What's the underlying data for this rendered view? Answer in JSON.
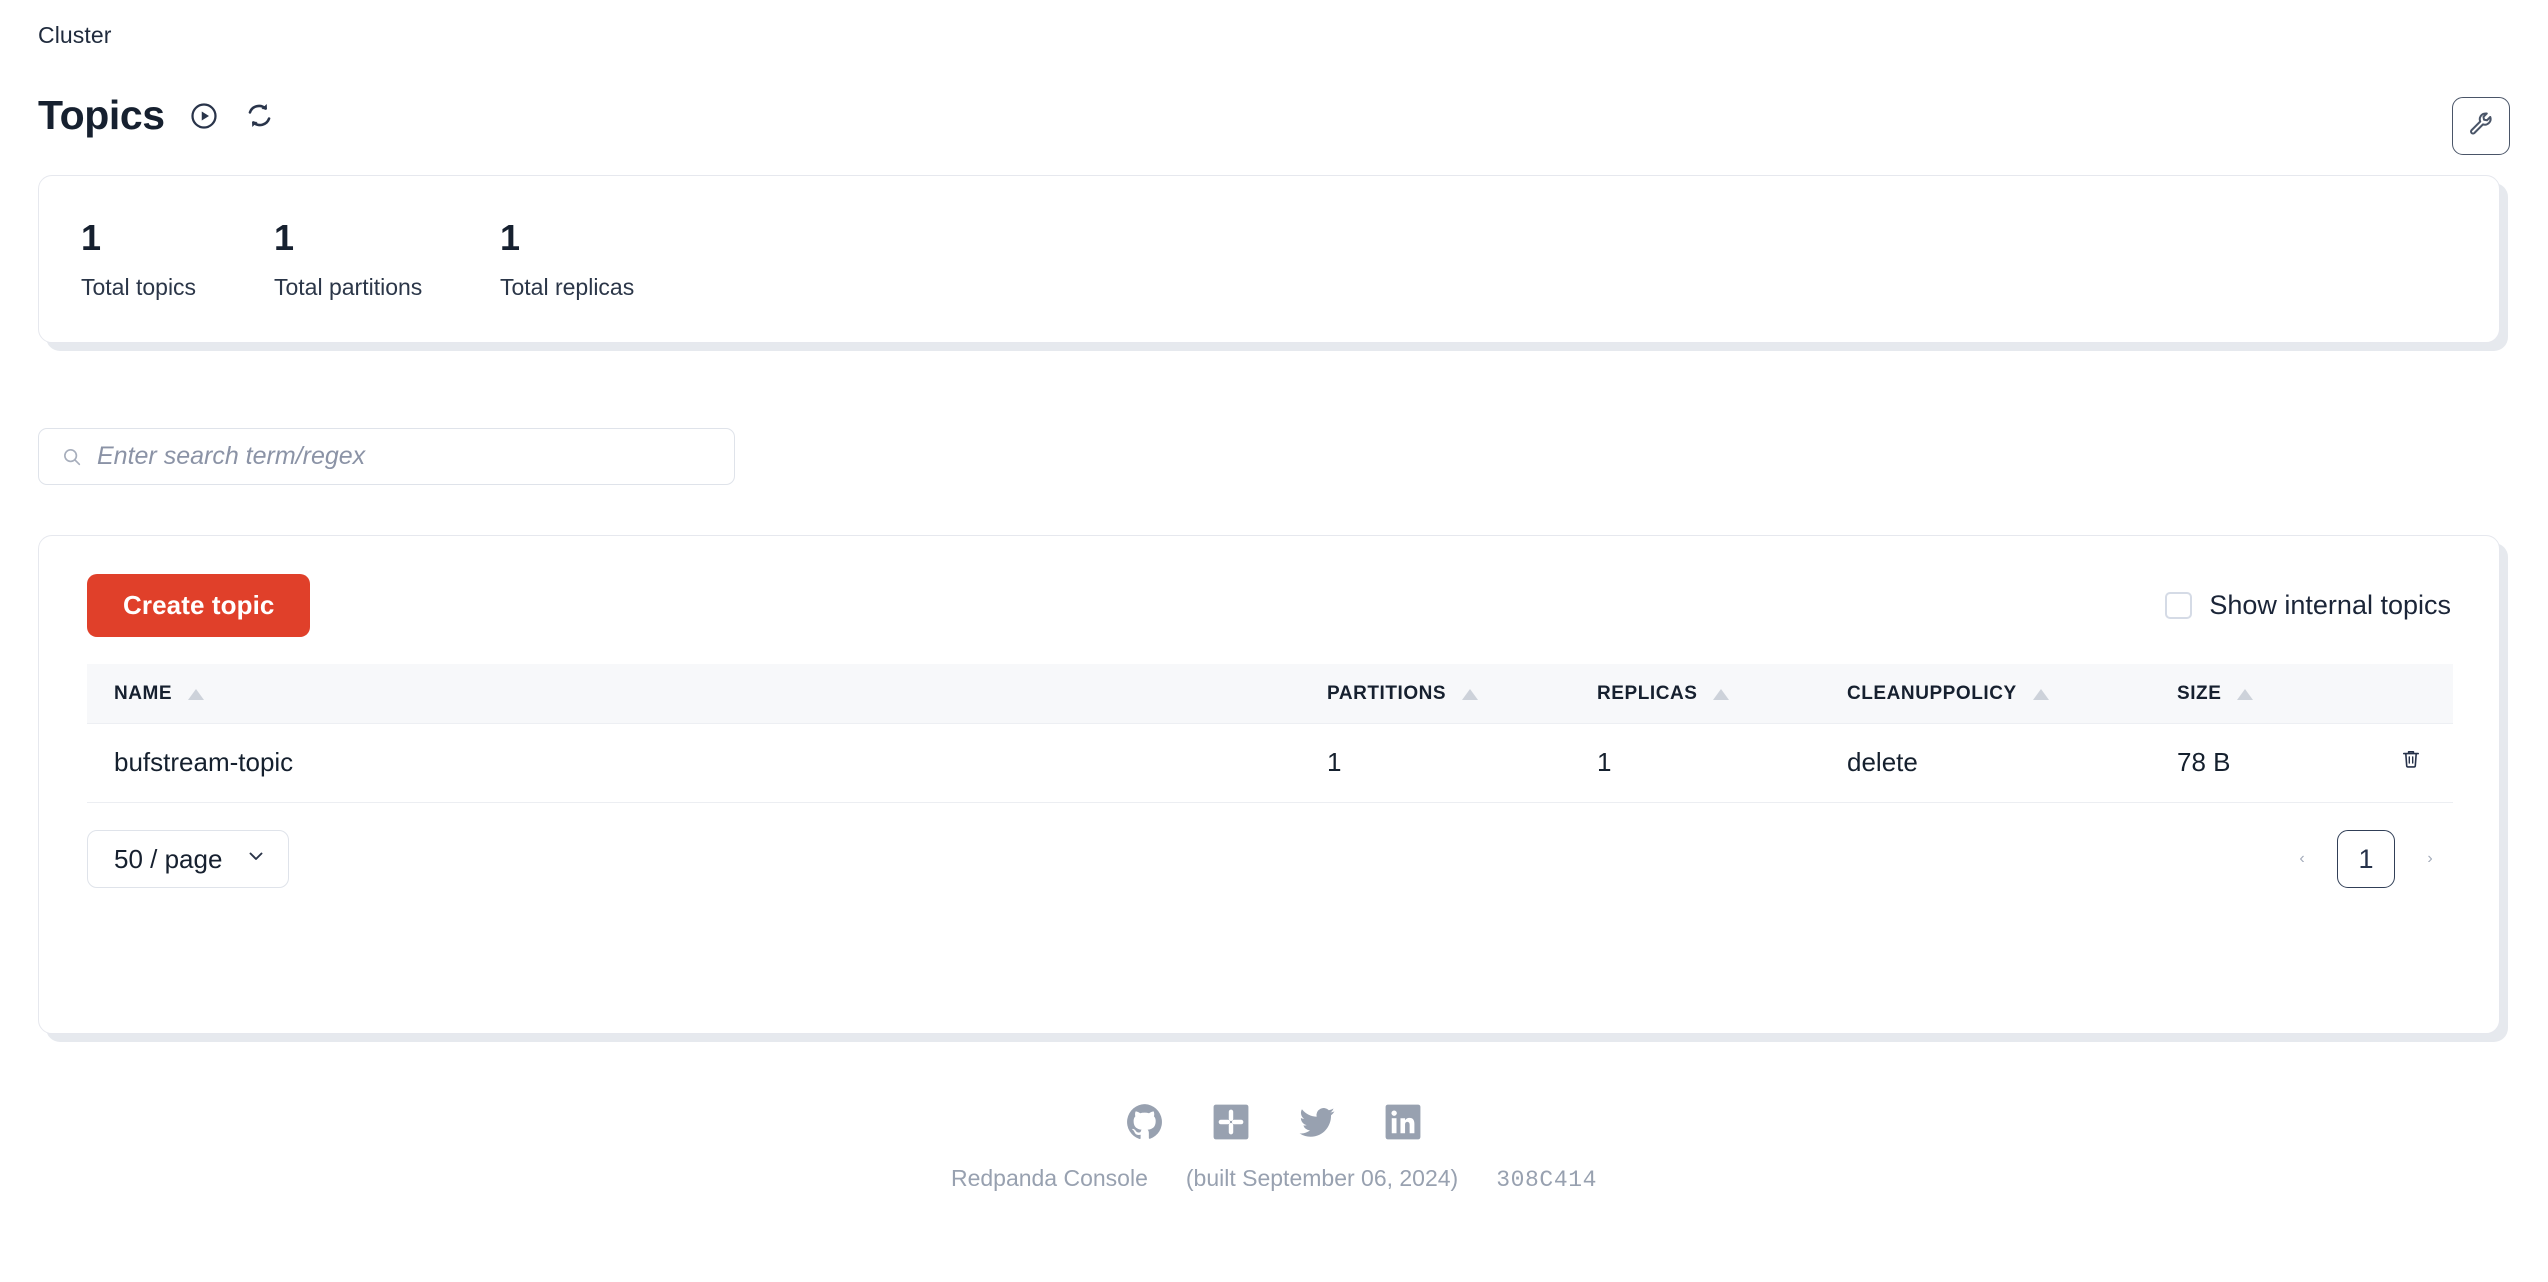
{
  "breadcrumb": "Cluster",
  "header": {
    "title": "Topics",
    "play_icon": "play-circle-icon",
    "refresh_icon": "refresh-icon",
    "tool_icon": "wrench-icon"
  },
  "stats": [
    {
      "value": "1",
      "label": "Total topics"
    },
    {
      "value": "1",
      "label": "Total partitions"
    },
    {
      "value": "1",
      "label": "Total replicas"
    }
  ],
  "search": {
    "placeholder": "Enter search term/regex",
    "value": "",
    "icon": "search-icon"
  },
  "toolbar": {
    "create_label": "Create topic",
    "internal_checkbox_label": "Show internal topics",
    "internal_checkbox_checked": false
  },
  "table": {
    "columns": [
      {
        "key": "name",
        "label": "NAME",
        "sortable": true
      },
      {
        "key": "partitions",
        "label": "PARTITIONS",
        "sortable": true
      },
      {
        "key": "replicas",
        "label": "REPLICAS",
        "sortable": true
      },
      {
        "key": "cleanuppolicy",
        "label": "CLEANUPPOLICY",
        "sortable": true
      },
      {
        "key": "size",
        "label": "SIZE",
        "sortable": true
      }
    ],
    "rows": [
      {
        "name": "bufstream-topic",
        "partitions": "1",
        "replicas": "1",
        "cleanuppolicy": "delete",
        "size": "78 B",
        "delete_icon": "trash-icon"
      }
    ]
  },
  "pagination": {
    "page_size_label": "50 / page",
    "chevron_icon": "chevron-down-icon",
    "prev_label": "‹",
    "next_label": "›",
    "current_page": "1"
  },
  "footer": {
    "socials": [
      {
        "name": "github-icon",
        "label": "GitHub"
      },
      {
        "name": "slack-icon",
        "label": "Slack"
      },
      {
        "name": "twitter-icon",
        "label": "Twitter"
      },
      {
        "name": "linkedin-icon",
        "label": "LinkedIn"
      }
    ],
    "product": "Redpanda Console",
    "build": "(built September 06, 2024)",
    "commit": "308C414"
  },
  "colors": {
    "accent": "#e0402a",
    "text": "#16202f",
    "muted": "#98a1b0",
    "border": "#e6e8ee",
    "header_bg": "#f7f8fa"
  }
}
